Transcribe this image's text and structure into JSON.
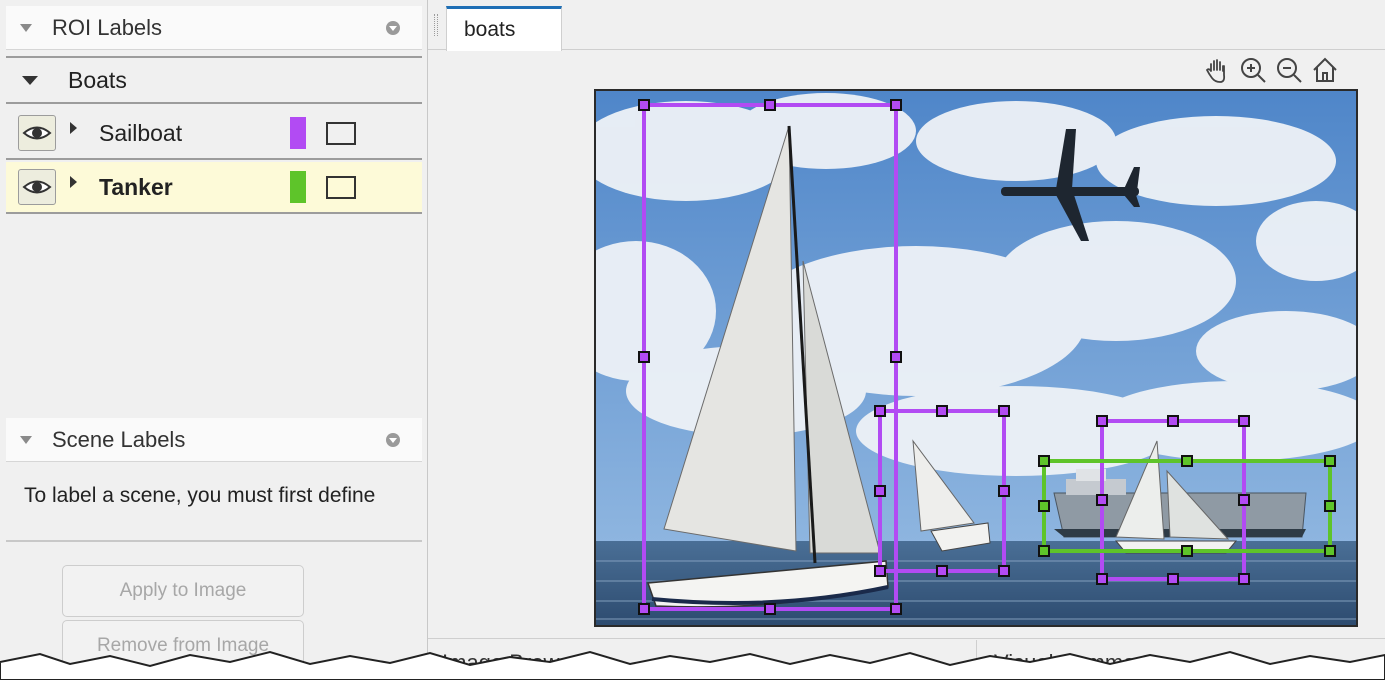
{
  "roi_labels": {
    "title": "ROI Labels",
    "group": {
      "name": "Boats"
    },
    "labels": [
      {
        "name": "Sailboat",
        "color": "#b24bf3"
      },
      {
        "name": "Tanker",
        "color": "#5ec42a"
      }
    ]
  },
  "scene_labels": {
    "title": "Scene Labels",
    "message": "To label a scene, you must first define"
  },
  "buttons": {
    "apply": "Apply to Image",
    "remove": "Remove from Image"
  },
  "document_tab": {
    "label": "boats"
  },
  "bottom_panes": {
    "image_browser": "Image Browser",
    "visual_summary": "Visual Summary"
  },
  "toolbar": {
    "tools": [
      "pan-icon",
      "zoom-in-icon",
      "zoom-out-icon",
      "home-icon"
    ]
  },
  "colors": {
    "sailboat": "#b24bf3",
    "tanker": "#5ec42a",
    "selected_row": "#fdfad8",
    "tab_accent": "#1f6fb5"
  }
}
